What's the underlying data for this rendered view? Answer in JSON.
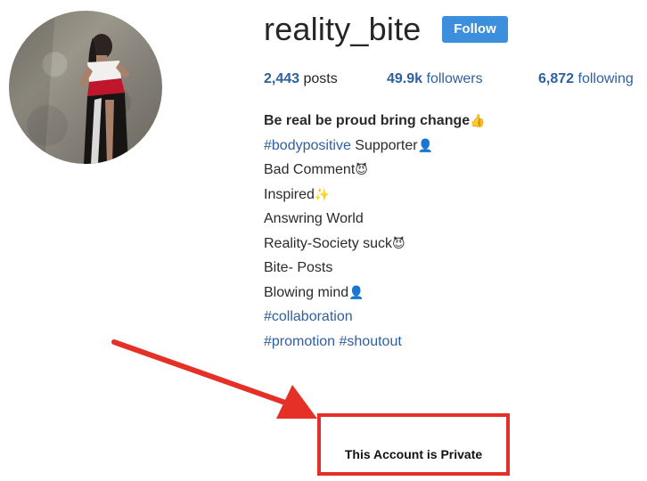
{
  "profile": {
    "username": "reality_bite",
    "follow_label": "Follow"
  },
  "stats": {
    "posts_count": "2,443",
    "posts_label": "posts",
    "followers_count": "49.9k",
    "followers_label": "followers",
    "following_count": "6,872",
    "following_label": "following"
  },
  "bio": {
    "line1_text": "Be real be proud bring change",
    "line1_emoji": "👍",
    "line2_tag": "#bodypositive",
    "line2_text": " Supporter",
    "line2_emoji": "👤",
    "line3_text": "Bad Comment",
    "line3_emoji": "😈",
    "line4_text": "Inspired",
    "line4_emoji": "✨",
    "line5_text": "Answring World",
    "line6_text": "Reality-Society suck",
    "line6_emoji": "😈",
    "line7_text": "Bite- Posts",
    "line8_text": "Blowing mind",
    "line8_emoji": "👤",
    "line9_tag": "#collaboration",
    "line10_tag1": "#promotion",
    "line10_tag2": "#shoutout"
  },
  "annotation": {
    "private_text": "This Account is Private",
    "accent_color": "#e53027"
  },
  "colors": {
    "follow_button": "#3c8fdc",
    "link_blue": "#2e5f9e"
  }
}
